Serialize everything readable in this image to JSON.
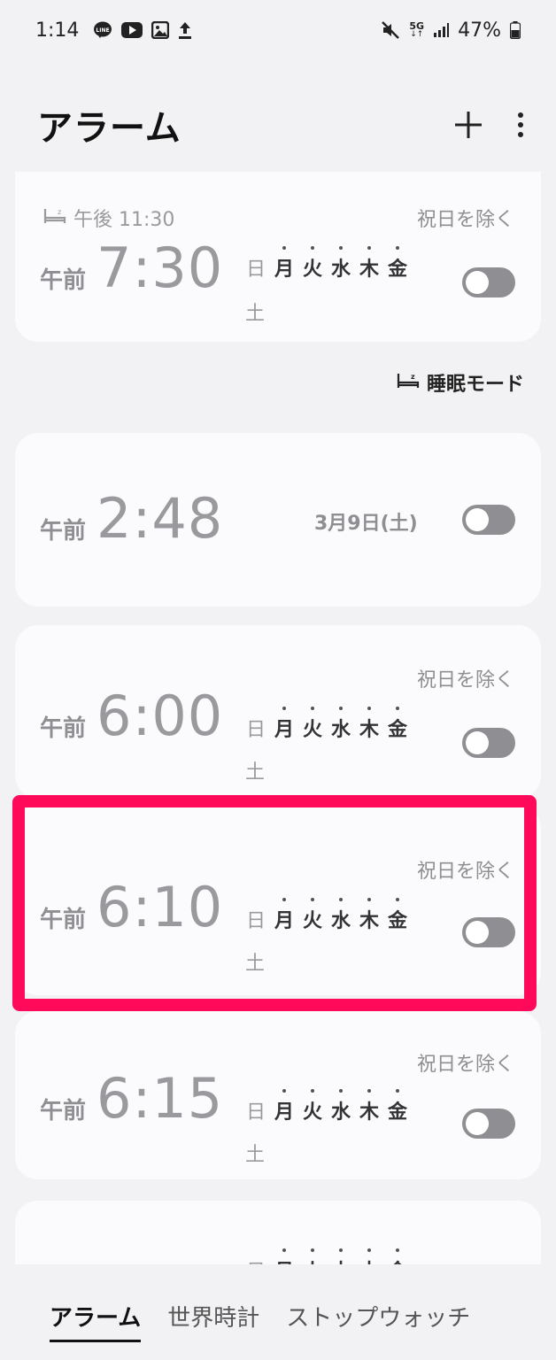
{
  "status_bar": {
    "time": "1:14",
    "line_badge": "LINE",
    "network": "5G",
    "battery": "47%",
    "icons": [
      "line-icon",
      "youtube-icon",
      "gallery-icon",
      "upload-icon",
      "mute-icon",
      "signal-icon",
      "battery-icon"
    ]
  },
  "header": {
    "title": "アラーム",
    "add_icon": "plus-icon",
    "menu_icon": "more-vertical-icon"
  },
  "sleep_mode_label": "睡眠モード",
  "alarms": [
    {
      "bedtime": "午後 11:30",
      "ampm": "午前",
      "time": "7:30",
      "holiday": "祝日を除く",
      "days": [
        "日",
        "月",
        "火",
        "水",
        "木",
        "金"
      ],
      "saturday": "土",
      "enabled": false
    },
    {
      "ampm": "午前",
      "time": "2:48",
      "date": "3月9日(土)",
      "enabled": false
    },
    {
      "ampm": "午前",
      "time": "6:00",
      "holiday": "祝日を除く",
      "days": [
        "日",
        "月",
        "火",
        "水",
        "木",
        "金"
      ],
      "saturday": "土",
      "enabled": false
    },
    {
      "ampm": "午前",
      "time": "6:10",
      "holiday": "祝日を除く",
      "days": [
        "日",
        "月",
        "火",
        "水",
        "木",
        "金"
      ],
      "saturday": "土",
      "enabled": false
    },
    {
      "ampm": "午前",
      "time": "6:15",
      "holiday": "祝日を除く",
      "days": [
        "日",
        "月",
        "火",
        "水",
        "木",
        "金"
      ],
      "saturday": "土",
      "enabled": false
    },
    {
      "days": [
        "日",
        "月",
        "火",
        "水",
        "木",
        "金"
      ]
    }
  ],
  "bottom_nav": {
    "tabs": [
      "アラーム",
      "世界時計",
      "ストップウォッチ"
    ],
    "active": 0
  },
  "colors": {
    "background": "#f2f2f4",
    "card": "#fbfbfd",
    "toggle_off": "#8e8e93",
    "highlight": "#ff0a5a"
  }
}
